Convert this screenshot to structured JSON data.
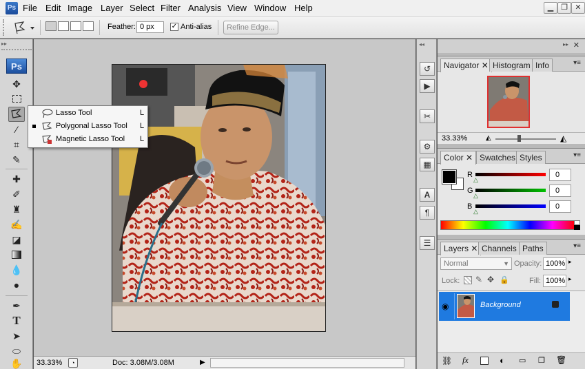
{
  "app": {
    "icon_label": "Ps"
  },
  "menu": [
    "File",
    "Edit",
    "Image",
    "Layer",
    "Select",
    "Filter",
    "Analysis",
    "View",
    "Window",
    "Help"
  ],
  "window_controls": {
    "minimize": "▁",
    "restore": "❐",
    "close": "✕"
  },
  "options": {
    "feather_label": "Feather:",
    "feather_value": "0 px",
    "antialias_label": "Anti-alias",
    "antialias_checked": "✓",
    "refine_edge_label": "Refine Edge..."
  },
  "toolbox": {
    "logo": "Ps"
  },
  "flyout": {
    "items": [
      {
        "label": "Lasso Tool",
        "key": "L",
        "icon": "lasso-icon"
      },
      {
        "label": "Polygonal Lasso Tool",
        "key": "L",
        "icon": "polygonal-lasso-icon",
        "selected": true
      },
      {
        "label": "Magnetic Lasso Tool",
        "key": "L",
        "icon": "magnetic-lasso-icon"
      }
    ]
  },
  "status": {
    "zoom": "33.33%",
    "doc": "Doc: 3.08M/3.08M"
  },
  "navigator": {
    "tabs": [
      "Navigator",
      "Histogram",
      "Info"
    ],
    "zoom": "33.33%"
  },
  "color": {
    "tabs": [
      "Color",
      "Swatches",
      "Styles"
    ],
    "r_label": "R",
    "g_label": "G",
    "b_label": "B",
    "r_value": "0",
    "g_value": "0",
    "b_value": "0",
    "foreground": "#000000",
    "background": "#ffffff"
  },
  "layers": {
    "tabs": [
      "Layers",
      "Channels",
      "Paths"
    ],
    "blend_mode": "Normal",
    "opacity_label": "Opacity:",
    "opacity_value": "100%",
    "lock_label": "Lock:",
    "fill_label": "Fill:",
    "fill_value": "100%",
    "rows": [
      {
        "name": "Background",
        "visible": true,
        "locked": true
      }
    ]
  },
  "colors": {
    "selection_blue": "#1f7ae0",
    "ps_blue": "#1d4f9e"
  }
}
